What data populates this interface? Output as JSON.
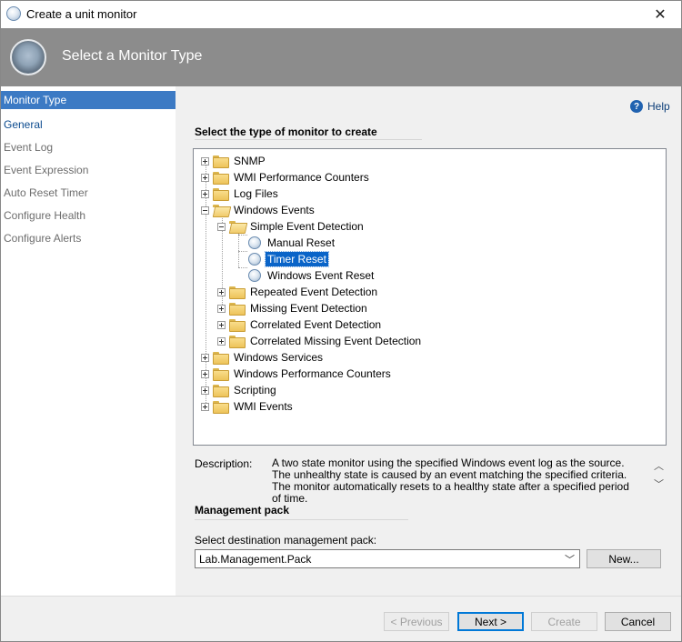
{
  "window": {
    "title": "Create a unit monitor",
    "close_glyph": "✕"
  },
  "header": {
    "title": "Select a Monitor Type"
  },
  "nav": {
    "items": [
      {
        "label": "Monitor Type",
        "state": "active"
      },
      {
        "label": "General",
        "state": "link"
      },
      {
        "label": "Event Log",
        "state": "disabled"
      },
      {
        "label": "Event Expression",
        "state": "disabled"
      },
      {
        "label": "Auto Reset Timer",
        "state": "disabled"
      },
      {
        "label": "Configure Health",
        "state": "disabled"
      },
      {
        "label": "Configure Alerts",
        "state": "disabled"
      }
    ]
  },
  "help": {
    "label": "Help",
    "icon_glyph": "?"
  },
  "tree_section": {
    "title": "Select the type of monitor to create"
  },
  "tree": {
    "nodes": [
      {
        "label": "SNMP",
        "icon": "folder-icon"
      },
      {
        "label": "WMI Performance Counters",
        "icon": "folder-icon"
      },
      {
        "label": "Log Files",
        "icon": "folder-icon"
      },
      {
        "label": "Windows Events",
        "icon": "folder-open-icon"
      },
      {
        "label": "Simple Event Detection",
        "icon": "folder-open-icon"
      },
      {
        "label": "Manual Reset",
        "icon": "monitor-icon"
      },
      {
        "label": "Timer Reset",
        "icon": "monitor-icon",
        "selected": true
      },
      {
        "label": "Windows Event Reset",
        "icon": "monitor-icon"
      },
      {
        "label": "Repeated Event Detection",
        "icon": "folder-icon"
      },
      {
        "label": "Missing Event Detection",
        "icon": "folder-icon"
      },
      {
        "label": "Correlated Event Detection",
        "icon": "folder-icon"
      },
      {
        "label": "Correlated Missing Event Detection",
        "icon": "folder-icon"
      },
      {
        "label": "Windows Services",
        "icon": "folder-icon"
      },
      {
        "label": "Windows Performance Counters",
        "icon": "folder-icon"
      },
      {
        "label": "Scripting",
        "icon": "folder-icon"
      },
      {
        "label": "WMI Events",
        "icon": "folder-icon"
      }
    ]
  },
  "description": {
    "label": "Description:",
    "text": "A two state monitor using the specified Windows event log as the source.  The unhealthy state is caused by an event matching the specified criteria.  The monitor automatically resets to a healthy state after a specified period of time.",
    "scroll_up_glyph": "︿",
    "scroll_down_glyph": "﹀"
  },
  "management_pack": {
    "title": "Management pack",
    "select_label": "Select destination management pack:",
    "selected_value": "Lab.Management.Pack",
    "chevron_glyph": "﹀",
    "new_button": "New..."
  },
  "footer": {
    "previous": "< Previous",
    "next": "Next >",
    "create": "Create",
    "cancel": "Cancel"
  }
}
